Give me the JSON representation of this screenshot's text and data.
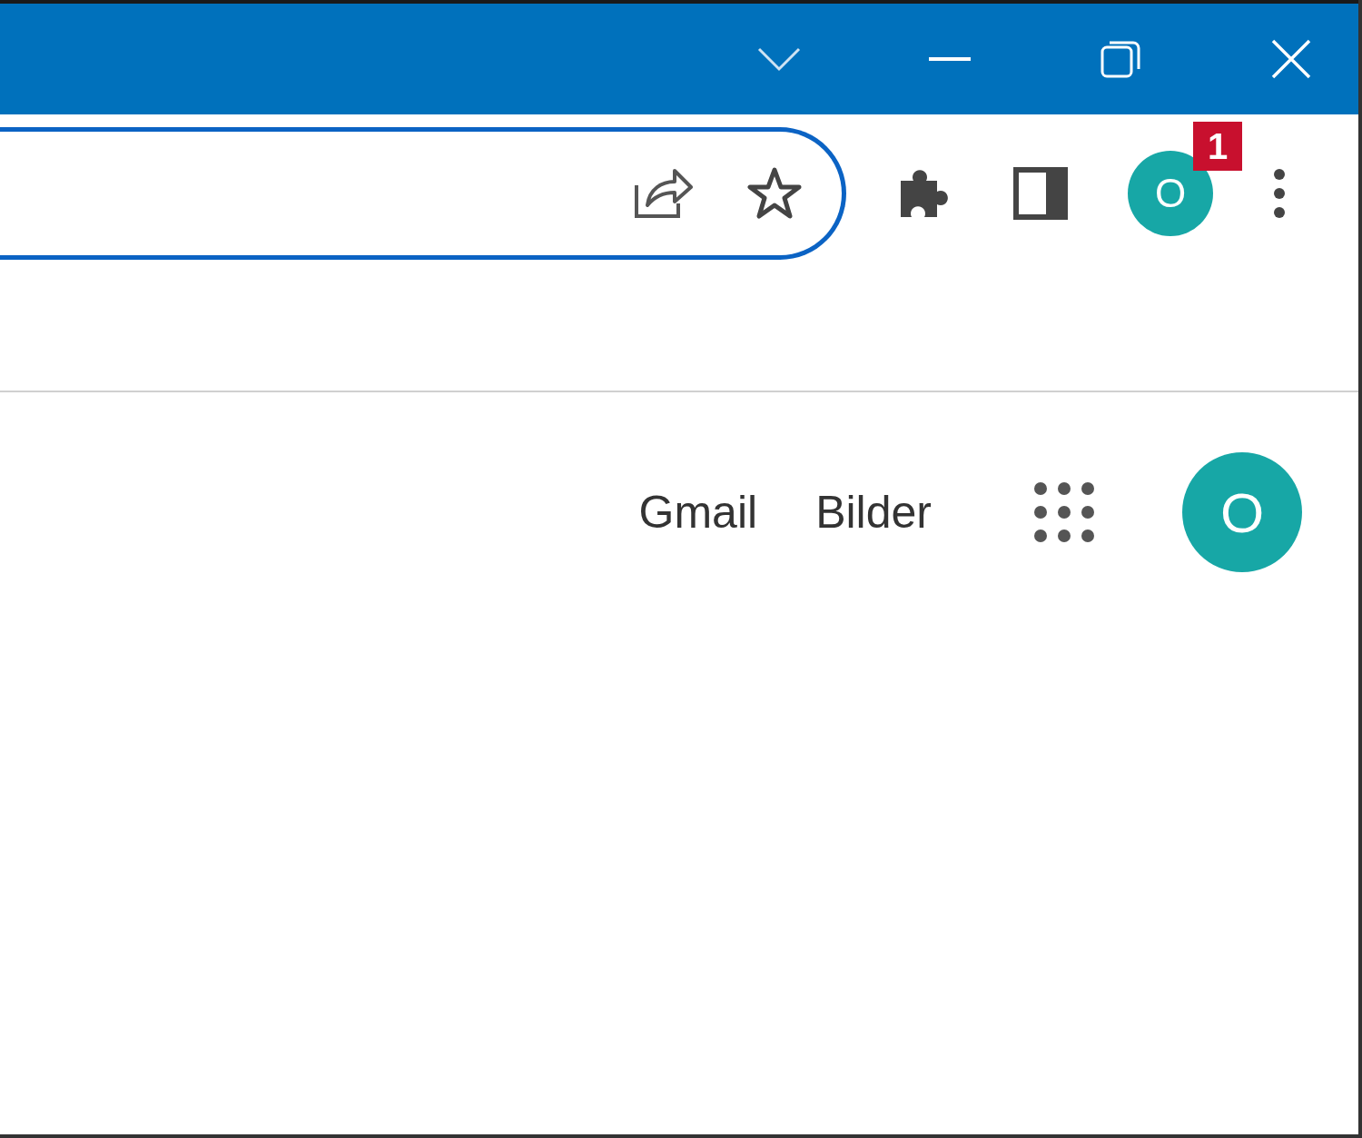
{
  "browser": {
    "profile_avatar": {
      "initial": "O",
      "badge": "1"
    }
  },
  "page": {
    "links": [
      "Gmail",
      "Bilder"
    ],
    "account_avatar": {
      "initial": "O"
    }
  }
}
